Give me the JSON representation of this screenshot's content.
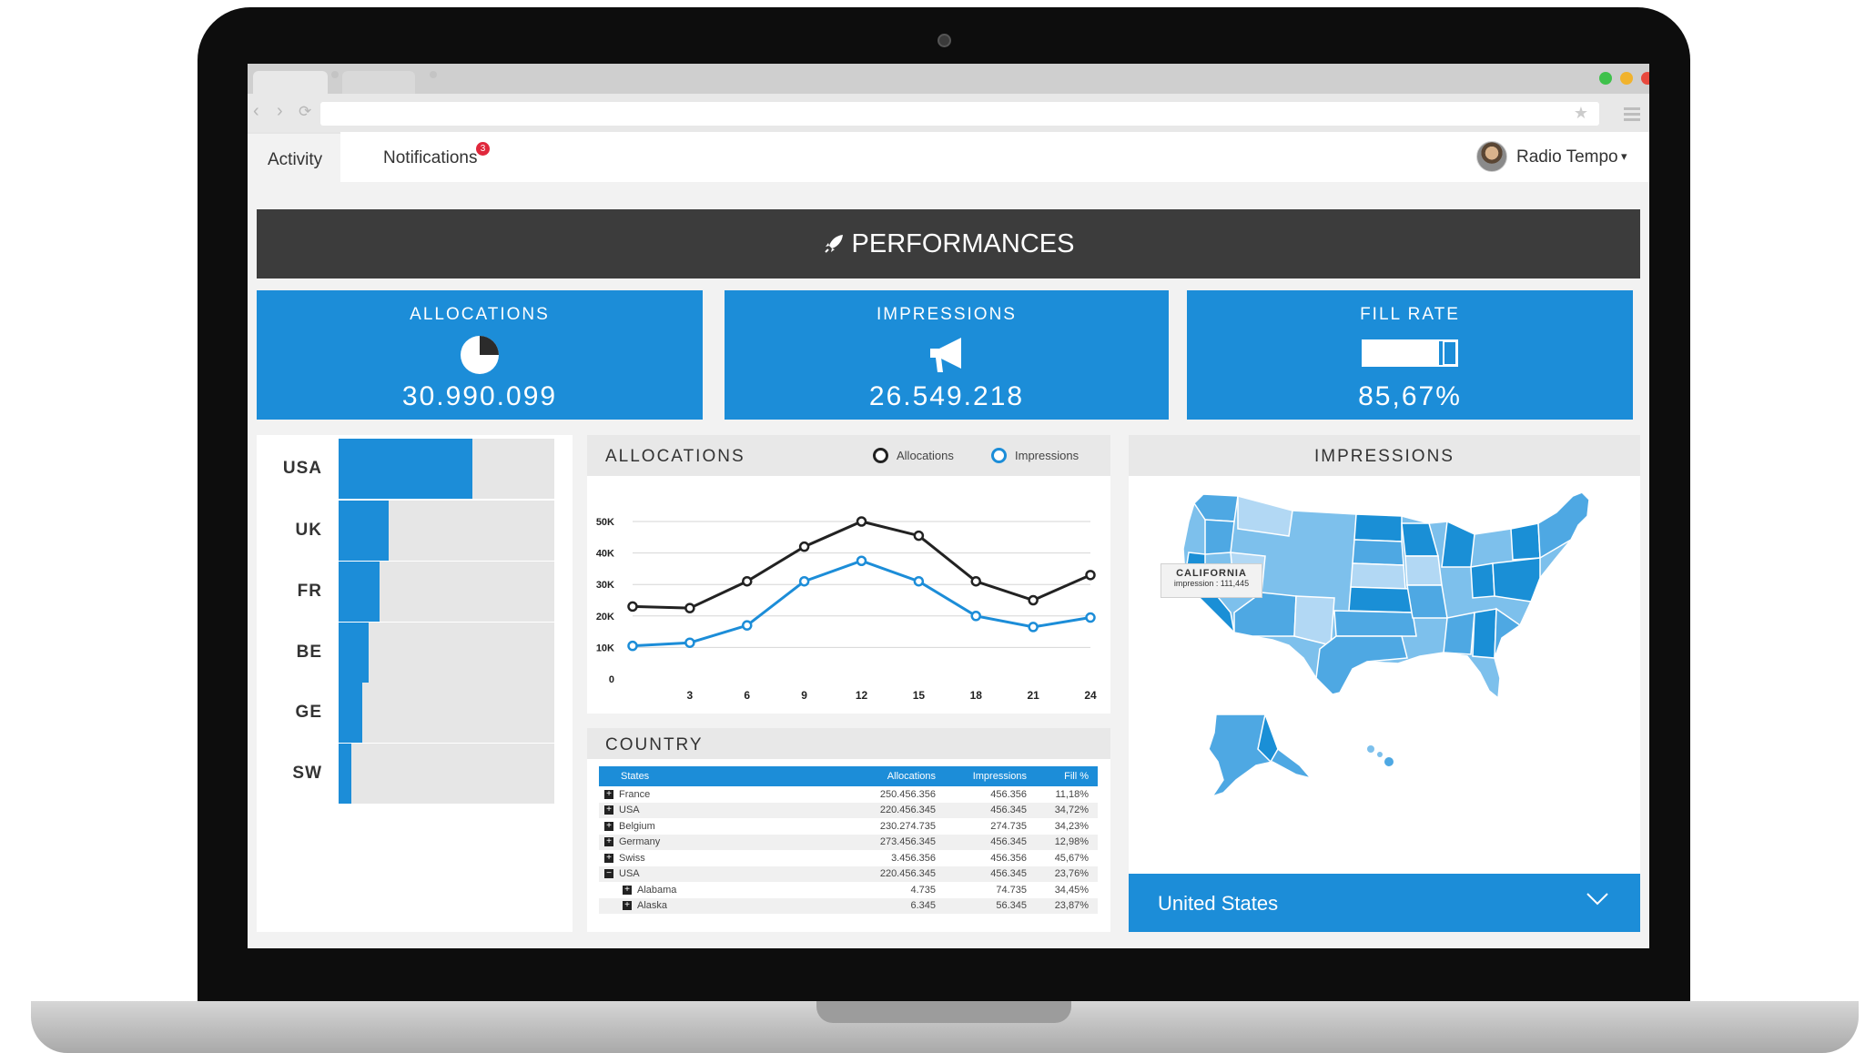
{
  "browser": {
    "star_glyph": "★"
  },
  "header": {
    "tabs": [
      {
        "label": "Activity"
      },
      {
        "label": "Notifications",
        "badge": "3"
      }
    ],
    "user": {
      "name": "Radio Tempo",
      "caret": "▾"
    }
  },
  "banner": {
    "title": "PERFORMANCES",
    "icon": "rocket-icon"
  },
  "kpis": [
    {
      "label": "ALLOCATIONS",
      "value": "30.990.099",
      "icon": "pie-chart-icon"
    },
    {
      "label": "IMPRESSIONS",
      "value": "26.549.218",
      "icon": "megaphone-icon"
    },
    {
      "label": "FILL RATE",
      "value": "85,67%",
      "icon": "battery-icon",
      "fill_fraction": 0.8567
    }
  ],
  "country_bars": [
    {
      "label": "USA",
      "fraction": 0.62
    },
    {
      "label": "UK",
      "fraction": 0.23
    },
    {
      "label": "FR",
      "fraction": 0.19
    },
    {
      "label": "BE",
      "fraction": 0.14
    },
    {
      "label": "GE",
      "fraction": 0.11
    },
    {
      "label": "SW",
      "fraction": 0.06
    }
  ],
  "allocations_chart": {
    "title": "ALLOCATIONS",
    "legend": [
      {
        "name": "Allocations",
        "color": "#222222"
      },
      {
        "name": "Impressions",
        "color": "#1c8dd8"
      }
    ]
  },
  "chart_data": {
    "type": "line",
    "x": [
      0,
      3,
      6,
      9,
      12,
      15,
      18,
      21,
      24
    ],
    "x_ticks": [
      "3",
      "6",
      "9",
      "12",
      "15",
      "18",
      "21",
      "24"
    ],
    "y_ticks": [
      "0",
      "10K",
      "20K",
      "30K",
      "40K",
      "50K"
    ],
    "ylim": [
      0,
      50000
    ],
    "xlim": [
      0,
      24
    ],
    "grid": true,
    "legend_position": "top-right",
    "series": [
      {
        "name": "Allocations",
        "color": "#222222",
        "values": [
          23000,
          22500,
          31000,
          42000,
          50000,
          45500,
          31000,
          25000,
          33000
        ]
      },
      {
        "name": "Impressions",
        "color": "#1c8dd8",
        "values": [
          10500,
          11500,
          17000,
          31000,
          37500,
          31000,
          20000,
          16500,
          19500
        ]
      }
    ]
  },
  "country_table": {
    "title": "COUNTRY",
    "columns": [
      "States",
      "Allocations",
      "Impressions",
      "Fill %"
    ],
    "rows": [
      {
        "expander": "+",
        "state": "France",
        "allocations": "250.456.356",
        "impressions": "456.356",
        "fill": "11,18%"
      },
      {
        "expander": "+",
        "state": "USA",
        "allocations": "220.456.345",
        "impressions": "456.345",
        "fill": "34,72%"
      },
      {
        "expander": "+",
        "state": "Belgium",
        "allocations": "230.274.735",
        "impressions": "274.735",
        "fill": "34,23%"
      },
      {
        "expander": "+",
        "state": "Germany",
        "allocations": "273.456.345",
        "impressions": "456.345",
        "fill": "12,98%"
      },
      {
        "expander": "+",
        "state": "Swiss",
        "allocations": "3.456.356",
        "impressions": "456.356",
        "fill": "45,67%"
      },
      {
        "expander": "−",
        "state": "USA",
        "allocations": "220.456.345",
        "impressions": "456.345",
        "fill": "23,76%"
      },
      {
        "expander": "+",
        "state": "Alabama",
        "allocations": "4.735",
        "impressions": "74.735",
        "fill": "34,45%",
        "child": true
      },
      {
        "expander": "+",
        "state": "Alaska",
        "allocations": "6.345",
        "impressions": "56.345",
        "fill": "23,87%",
        "child": true
      }
    ]
  },
  "impressions_map": {
    "title": "IMPRESSIONS",
    "tooltip": {
      "state": "CALIFORNIA",
      "value": "impression : 111,445"
    },
    "selected_country": "United States",
    "colors": [
      "#1a8fd6",
      "#4ea8e3",
      "#7dc0ec",
      "#b2d8f4"
    ]
  },
  "theme": {
    "accent": "#1c8dd8",
    "banner_bg": "#3c3c3c",
    "panel_head": "#e8e8e8"
  }
}
